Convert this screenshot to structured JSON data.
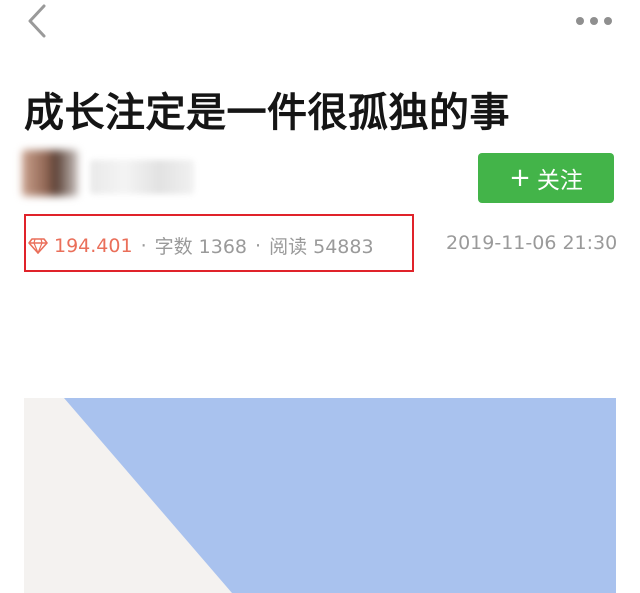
{
  "nav": {
    "back_icon": "chevron-left-icon",
    "more_icon": "more-horizontal-icon"
  },
  "article": {
    "title": "成长注定是一件很孤独的事",
    "author_name": "",
    "follow_label": "关注",
    "diamond_score": "194.401",
    "word_count_label": "字数 1368",
    "read_count_label": "阅读 54883",
    "publish_time": "2019-11-06 21:30"
  },
  "colors": {
    "accent_green": "#43b449",
    "score_red": "#ea6f5a",
    "highlight_box": "#e0232a",
    "cover_blue": "#a9c2ee",
    "cover_white": "#f4f2f0"
  }
}
